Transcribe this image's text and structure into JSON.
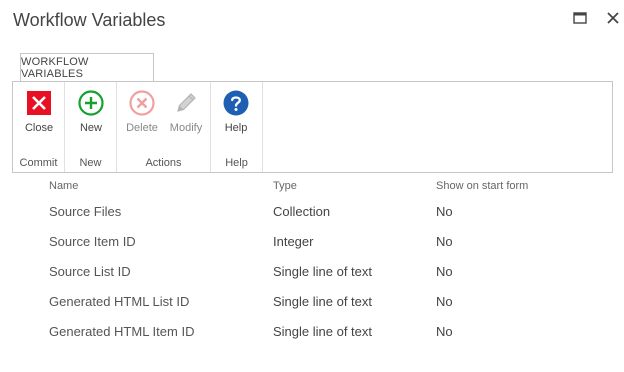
{
  "dialog": {
    "title": "Workflow Variables"
  },
  "ribbon": {
    "tab_label": "WORKFLOW VARIABLES",
    "groups": [
      {
        "label": "Commit",
        "buttons": [
          {
            "label": "Close",
            "icon": "close-icon",
            "color": "#e81123"
          }
        ]
      },
      {
        "label": "New",
        "buttons": [
          {
            "label": "New",
            "icon": "add-circle-icon",
            "color": "#16a02e"
          }
        ]
      },
      {
        "label": "Actions",
        "buttons": [
          {
            "label": "Delete",
            "icon": "delete-circle-icon",
            "color": "#f0a0a0"
          },
          {
            "label": "Modify",
            "icon": "pencil-icon",
            "color": "#b4b4b4"
          }
        ]
      },
      {
        "label": "Help",
        "buttons": [
          {
            "label": "Help",
            "icon": "help-icon",
            "color": "#1e5fb4"
          }
        ]
      }
    ]
  },
  "table": {
    "headers": [
      "Name",
      "Type",
      "Show on start form"
    ],
    "rows": [
      {
        "name": "Source Files",
        "type": "Collection",
        "show": "No"
      },
      {
        "name": "Source Item ID",
        "type": "Integer",
        "show": "No"
      },
      {
        "name": "Source List ID",
        "type": "Single line of text",
        "show": "No"
      },
      {
        "name": "Generated HTML List ID",
        "type": "Single line of text",
        "show": "No"
      },
      {
        "name": "Generated HTML Item ID",
        "type": "Single line of text",
        "show": "No"
      }
    ]
  }
}
